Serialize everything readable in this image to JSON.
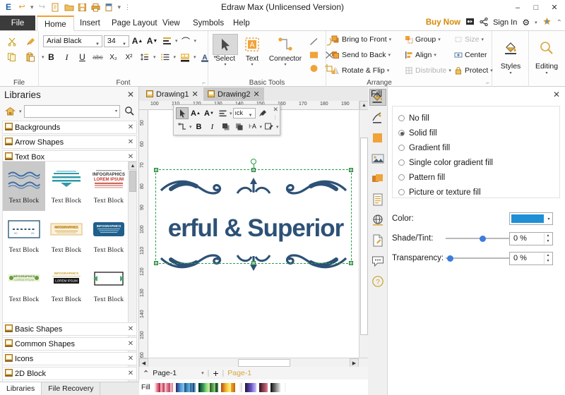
{
  "window": {
    "title": "Edraw Max (Unlicensed Version)",
    "minimize": "–",
    "maximize": "□",
    "close": "✕"
  },
  "quick_access": [
    {
      "name": "app-logo-icon",
      "glyph": "E"
    },
    {
      "name": "undo-icon",
      "glyph": "↩"
    },
    {
      "name": "undo-dropdown-icon",
      "glyph": "▾"
    },
    {
      "name": "redo-icon",
      "glyph": "↪"
    },
    {
      "name": "new-icon",
      "glyph": "🗋"
    },
    {
      "name": "open-icon",
      "glyph": "🗀"
    },
    {
      "name": "save-icon",
      "glyph": "🖫"
    },
    {
      "name": "print-icon",
      "glyph": "🖶"
    },
    {
      "name": "export-icon",
      "glyph": "🗎"
    },
    {
      "name": "export-dropdown-icon",
      "glyph": "▾"
    },
    {
      "name": "customize-qat-icon",
      "glyph": "▾"
    }
  ],
  "ribbon_tabs": [
    {
      "label": "File",
      "state": "file"
    },
    {
      "label": "Home",
      "state": "active"
    },
    {
      "label": "Insert",
      "state": "normal"
    },
    {
      "label": "Page Layout",
      "state": "normal"
    },
    {
      "label": "View",
      "state": "normal"
    },
    {
      "label": "Symbols",
      "state": "normal"
    },
    {
      "label": "Help",
      "state": "normal"
    }
  ],
  "tab_right": {
    "buy_now": "Buy Now",
    "share_account_icon": "▣",
    "share_icon": "⦖",
    "sign_in": "Sign In",
    "settings_icon": "⚙",
    "settings_caret": "▾",
    "theme_icon": "✳",
    "collapse_icon": "⌃"
  },
  "ribbon": {
    "groups": [
      {
        "name": "file",
        "label": "File"
      },
      {
        "name": "font",
        "label": "Font"
      },
      {
        "name": "basic-tools",
        "label": "Basic Tools"
      },
      {
        "name": "arrange",
        "label": "Arrange"
      }
    ],
    "file_group": {
      "cut": "✂",
      "format_painter": "🖌",
      "copy": "⧉",
      "paste": "📋",
      "paste_caret": "▾"
    },
    "font_group": {
      "font_name": "Arial Black",
      "font_size": "34",
      "grow_font": "A",
      "shrink_font": "A",
      "align_icon": "▤",
      "curve_text_icon": "⌒",
      "bold": "B",
      "italic": "I",
      "underline": "U",
      "strike": "abc",
      "subscript": "X₂",
      "superscript": "X²",
      "line_spacing": "↕≡",
      "bullets": "☰",
      "highlight": "▨",
      "font_color": "A"
    },
    "basic_tools": [
      {
        "label": "Select",
        "icon": "selection-arrow-icon",
        "glyph": "➤",
        "selected": true
      },
      {
        "label": "Text",
        "icon": "text-tool-icon",
        "glyph": "A",
        "selected": false
      },
      {
        "label": "Connector",
        "icon": "connector-tool-icon",
        "glyph": "⌐",
        "selected": false
      }
    ],
    "shape_tools": [
      {
        "name": "line-tool-icon",
        "glyph": "╱"
      },
      {
        "name": "arc-tool-icon",
        "glyph": "⌒"
      },
      {
        "name": "rectangle-tool-icon",
        "glyph": "■"
      },
      {
        "name": "cross-tool-icon",
        "glyph": "✕"
      },
      {
        "name": "ellipse-tool-icon",
        "glyph": "●"
      },
      {
        "name": "crop-tool-icon",
        "glyph": "⛶"
      }
    ],
    "arrange": [
      {
        "label": "Bring to Front",
        "icon": "bring-to-front-icon",
        "glyph": "▣",
        "caret": "▾",
        "disabled": false
      },
      {
        "label": "Send to Back",
        "icon": "send-to-back-icon",
        "glyph": "▣",
        "caret": "▾",
        "disabled": false
      },
      {
        "label": "Rotate & Flip",
        "icon": "rotate-flip-icon",
        "glyph": "◢",
        "caret": "▾",
        "disabled": false
      },
      {
        "label": "Group",
        "icon": "group-icon",
        "glyph": "▥",
        "caret": "▾",
        "disabled": false
      },
      {
        "label": "Align",
        "icon": "align-icon",
        "glyph": "≣",
        "caret": "▾",
        "disabled": false
      },
      {
        "label": "Distribute",
        "icon": "distribute-icon",
        "glyph": "▦",
        "caret": "▾",
        "disabled": true
      },
      {
        "label": "Size",
        "icon": "size-icon",
        "glyph": "⬚",
        "caret": "▾",
        "disabled": true
      },
      {
        "label": "Center",
        "icon": "center-icon",
        "glyph": "⊡",
        "caret": "",
        "disabled": false
      },
      {
        "label": "Protect",
        "icon": "lock-icon",
        "glyph": "🔒",
        "caret": "▾",
        "disabled": false
      }
    ],
    "styles": {
      "label": "Styles",
      "icon": "fill-bucket-icon",
      "glyph": "🜄",
      "caret": "▾"
    },
    "editing": {
      "label": "Editing",
      "icon": "magnifier-icon",
      "glyph": "🔍",
      "caret": "▾"
    }
  },
  "libraries": {
    "title": "Libraries",
    "close": "✕",
    "home_icon": "🏠",
    "home_caret": "▾",
    "search_placeholder": "",
    "search_value": "",
    "search_caret": "▾",
    "search_icon": "🔍",
    "categories_top": [
      {
        "label": "Backgrounds",
        "expanded": false
      },
      {
        "label": "Arrow Shapes",
        "expanded": false
      },
      {
        "label": "Text Box",
        "expanded": true
      }
    ],
    "shapes": [
      {
        "label": "Text Block",
        "style": "wave-lines",
        "selected": true
      },
      {
        "label": "Text Block",
        "style": "teal-banner",
        "selected": false
      },
      {
        "label": "Text Block",
        "style": "infographics-red",
        "selected": false
      },
      {
        "label": "Text Block",
        "style": "dashed-frame",
        "selected": false
      },
      {
        "label": "Text Block",
        "style": "cream-ribbon",
        "selected": false
      },
      {
        "label": "Text Block",
        "style": "navy-plate",
        "selected": false
      },
      {
        "label": "Text Block",
        "style": "green-badge",
        "selected": false
      },
      {
        "label": "Text Block",
        "style": "black-bar",
        "selected": false
      },
      {
        "label": "Text Block",
        "style": "arrow-frame",
        "selected": false
      }
    ],
    "scroll_up": "▲",
    "scroll_down": "▼",
    "categories_bottom": [
      {
        "label": "Basic Shapes"
      },
      {
        "label": "Common Shapes"
      },
      {
        "label": "Icons"
      },
      {
        "label": "2D Block"
      }
    ],
    "bottom_tabs": [
      {
        "label": "Libraries",
        "active": true
      },
      {
        "label": "File Recovery",
        "active": false
      }
    ]
  },
  "canvas": {
    "document_tabs": [
      {
        "label": "Drawing1",
        "active": false,
        "close": "✕"
      },
      {
        "label": "Drawing2",
        "active": true,
        "close": "✕"
      }
    ],
    "h_ruler_ticks": [
      "100",
      "110",
      "120",
      "130",
      "140",
      "150",
      "160",
      "170",
      "180",
      "190"
    ],
    "v_ruler_ticks": [
      "50",
      "60",
      "70",
      "80",
      "90",
      "100",
      "110",
      "120",
      "130",
      "140",
      "150",
      "160"
    ],
    "artwork_text": "erful & Superior",
    "artwork_color": "#2d5176",
    "scroll_up": "▲",
    "scroll_down": "▼",
    "scroll_left": "◀",
    "scroll_right": "▶"
  },
  "mini_toolbar": {
    "select_icon": "➤",
    "grow_font_icon": "A",
    "shrink_font_icon": "A",
    "align_icon": "▤",
    "align_caret": "▾",
    "font_value": "ıck",
    "font_caret": "▾",
    "painter_icon": "🖌",
    "connector_icon": "⌐",
    "connector_caret": "▾",
    "bold": "B",
    "italic": "I",
    "front_icon": "▣",
    "back_icon": "▣",
    "spacing_icon": "↔A",
    "spacing_caret": "▾",
    "edit_icon": "🖉",
    "edit_caret": "▾",
    "close": "✕",
    "grip": "⋮"
  },
  "page_bar": {
    "collapse_icon": "⌃",
    "page_label": "Page-1",
    "page_caret": "▾",
    "divider": "|",
    "add_icon": "+",
    "divider2": "|",
    "page_tab": "Page-1"
  },
  "fill_status_bar": {
    "label": "Fill"
  },
  "right_strip": [
    {
      "name": "fill-panel-icon",
      "glyph": "🜄",
      "selected": true
    },
    {
      "name": "line-panel-icon",
      "glyph": "✑",
      "selected": false
    },
    {
      "name": "shadow-panel-icon",
      "glyph": "▢",
      "selected": false
    },
    {
      "name": "picture-panel-icon",
      "glyph": "🖼",
      "selected": false
    },
    {
      "name": "layers-panel-icon",
      "glyph": "▤",
      "selected": false
    },
    {
      "name": "properties-panel-icon",
      "glyph": "📋",
      "selected": false
    },
    {
      "name": "hyperlink-panel-icon",
      "glyph": "🌐",
      "selected": false
    },
    {
      "name": "note-panel-icon",
      "glyph": "🗒",
      "selected": false
    },
    {
      "name": "comment-panel-icon",
      "glyph": "💬",
      "selected": false
    },
    {
      "name": "help-panel-icon",
      "glyph": "?",
      "selected": false
    }
  ],
  "fill_panel": {
    "title": "Fill",
    "close": "✕",
    "options": [
      {
        "label": "No fill",
        "selected": false
      },
      {
        "label": "Solid fill",
        "selected": true
      },
      {
        "label": "Gradient fill",
        "selected": false
      },
      {
        "label": "Single color gradient fill",
        "selected": false
      },
      {
        "label": "Pattern fill",
        "selected": false
      },
      {
        "label": "Picture or texture fill",
        "selected": false
      }
    ],
    "color_label": "Color:",
    "color_value": "#1f8fd6",
    "color_caret": "▾",
    "shade_label": "Shade/Tint:",
    "shade_value": "0 %",
    "shade_percent": 50,
    "transparency_label": "Transparency:",
    "transparency_value": "0 %",
    "transparency_percent": 2
  }
}
